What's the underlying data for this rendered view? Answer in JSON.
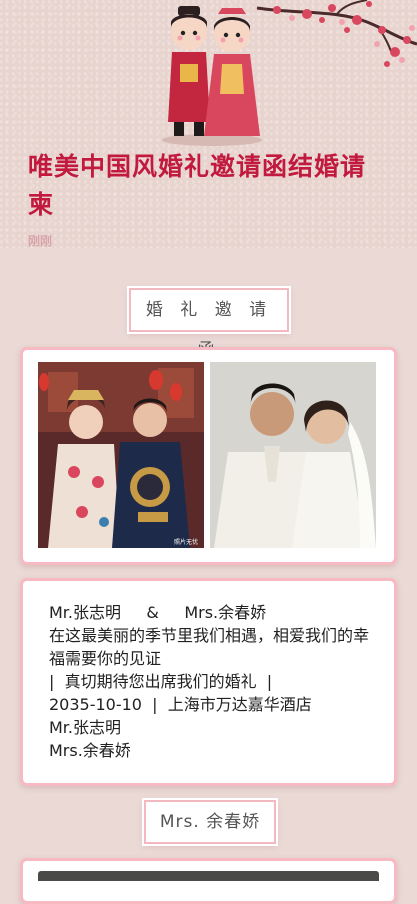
{
  "hero": {
    "title": "唯美中国风婚礼邀请函结婚请柬",
    "subtitle": "刚刚"
  },
  "sections": {
    "invite_title": "婚 礼 邀 请 函",
    "name_pill": "Mrs. 余春娇"
  },
  "invitation": {
    "line1": "Mr.张志明     &     Mrs.余春娇",
    "line2": "在这最美丽的季节里我们相遇，相爱我们的幸福需要你的见证",
    "line3": "|  真切期待您出席我们的婚礼  |",
    "line4": "2035-10-10  |  上海市万达嘉华酒店",
    "line5": "Mr.张志明",
    "line6": "Mrs.余春娇"
  },
  "photos": {
    "left_watermark": "照片无忧"
  },
  "colors": {
    "accent": "#c11a3e",
    "card_border": "#f7b9c2",
    "page_bg": "#ead9d5"
  }
}
